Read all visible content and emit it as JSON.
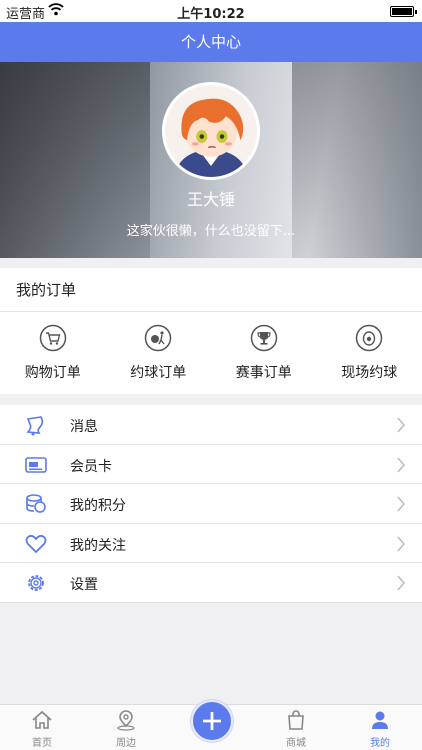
{
  "status_bar": {
    "carrier": "运营商",
    "time": "上午10:22",
    "battery_level": 1.0
  },
  "nav": {
    "title": "个人中心"
  },
  "profile": {
    "name": "王大锤",
    "bio": "这家伙很懒，什么也没留下..."
  },
  "orders": {
    "title": "我的订单",
    "items": [
      {
        "label": "购物订单",
        "icon": "shopping-cart-icon"
      },
      {
        "label": "约球订单",
        "icon": "ball-player-icon"
      },
      {
        "label": "赛事订单",
        "icon": "trophy-icon"
      },
      {
        "label": "现场约球",
        "icon": "court-ball-icon"
      }
    ]
  },
  "menu": {
    "items": [
      {
        "label": "消息",
        "icon": "bell-icon"
      },
      {
        "label": "会员卡",
        "icon": "vip-card-icon"
      },
      {
        "label": "我的积分",
        "icon": "coins-icon"
      },
      {
        "label": "我的关注",
        "icon": "heart-icon"
      },
      {
        "label": "设置",
        "icon": "gear-icon"
      }
    ]
  },
  "tabbar": {
    "items": [
      {
        "label": "首页",
        "icon": "home-icon"
      },
      {
        "label": "周边",
        "icon": "location-pin-icon"
      },
      {
        "label": "商城",
        "icon": "shopping-bag-icon"
      },
      {
        "label": "我的",
        "icon": "user-icon"
      }
    ],
    "active": "我的",
    "fab_icon": "plus-icon"
  },
  "colors": {
    "accent": "#5b7bec",
    "text": "#222222",
    "muted": "#888888"
  }
}
